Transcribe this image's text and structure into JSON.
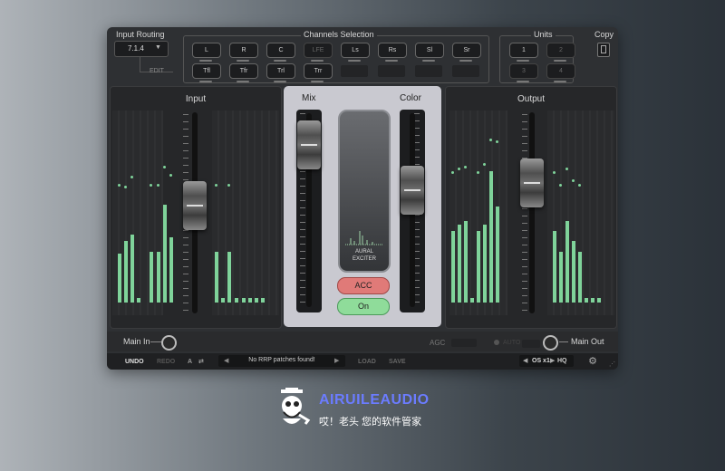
{
  "routing": {
    "title": "Input Routing",
    "value": "7.1.4",
    "edit": "EDIT"
  },
  "channels": {
    "title": "Channels Selection",
    "row1": [
      "L",
      "R",
      "C",
      "LFE",
      "Ls",
      "Rs",
      "Sl",
      "Sr"
    ],
    "row2": [
      "Tfl",
      "Tfr",
      "Trl",
      "Trr"
    ]
  },
  "units": {
    "title": "Units",
    "buttons": [
      "1",
      "2",
      "3",
      "4"
    ]
  },
  "copy": {
    "title": "Copy"
  },
  "input": {
    "title": "Input",
    "fader_level": 0.6
  },
  "output": {
    "title": "Output",
    "fader_level": 0.72
  },
  "mix": {
    "title": "Mix",
    "fader_level": 0.9
  },
  "color": {
    "title": "Color",
    "fader_level": 0.62
  },
  "display": {
    "line1": "AURAL",
    "line2": "EXCITER"
  },
  "acc_label": "ACC",
  "on_label": "On",
  "main_in": "Main In",
  "main_out": "Main Out",
  "agc": "AGC",
  "auto": "AUTO",
  "footer": {
    "undo": "UNDO",
    "redo": "REDO",
    "a": "A",
    "preset": "No RRP patches found!",
    "load": "LOAD",
    "save": "SAVE",
    "os": "OS x1",
    "hq": "HQ"
  },
  "watermark": {
    "brand": "AIRUILEAUDIO",
    "tagline": "哎！老头 您的软件管家"
  },
  "colors": {
    "meter": "#7fd39a",
    "acc": "#e07a78",
    "on": "#8fdc9a",
    "brand": "#6b7cff"
  }
}
